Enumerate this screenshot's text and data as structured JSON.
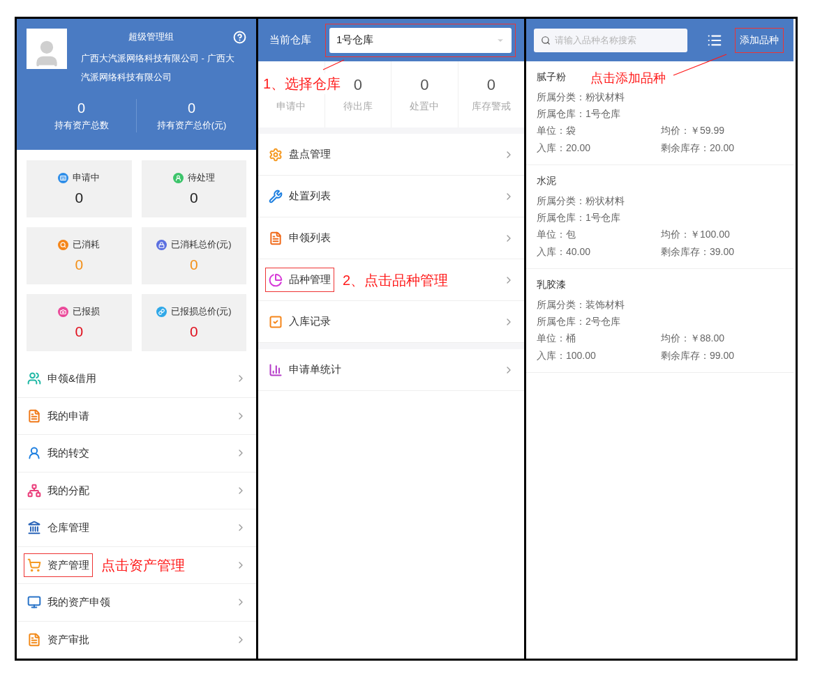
{
  "asset_screen": {
    "profile": {
      "role": "超级管理组",
      "company": "广西大汽派网络科技有限公司 - 广西大汽派网络科技有限公司"
    },
    "totals": [
      {
        "value": "0",
        "label": "持有资产总数"
      },
      {
        "value": "0",
        "label": "持有资产总价(元)"
      }
    ],
    "stat_cards": [
      {
        "label": "申请中",
        "value": "0",
        "color": "#222222"
      },
      {
        "label": "待处理",
        "value": "0",
        "color": "#222222"
      },
      {
        "label": "已消耗",
        "value": "0",
        "color": "#f39019"
      },
      {
        "label": "已消耗总价(元)",
        "value": "0",
        "color": "#f39019"
      },
      {
        "label": "已报损",
        "value": "0",
        "color": "#e0101e"
      },
      {
        "label": "已报损总价(元)",
        "value": "0",
        "color": "#e0101e"
      }
    ],
    "menu": [
      {
        "label": "申领&借用",
        "highlighted": false
      },
      {
        "label": "我的申请",
        "highlighted": false
      },
      {
        "label": "我的转交",
        "highlighted": false
      },
      {
        "label": "我的分配",
        "highlighted": false
      },
      {
        "label": "仓库管理",
        "highlighted": false
      },
      {
        "label": "资产管理",
        "highlighted": true,
        "note": "点击资产管理"
      },
      {
        "label": "我的资产申领",
        "highlighted": false
      },
      {
        "label": "资产审批",
        "highlighted": false
      }
    ]
  },
  "warehouse_screen": {
    "header": {
      "label": "当前仓库",
      "select_value": "1号仓库",
      "highlighted": true,
      "note": "1、选择仓库"
    },
    "counters": [
      {
        "label": "申请中"
      },
      {
        "value": "0",
        "label": "待出库"
      },
      {
        "value": "0",
        "label": "处置中"
      },
      {
        "value": "0",
        "label": "库存警戒"
      }
    ],
    "menu_groups": [
      [
        {
          "label": "盘点管理",
          "highlighted": false
        },
        {
          "label": "处置列表",
          "highlighted": false
        },
        {
          "label": "申领列表",
          "highlighted": false
        },
        {
          "label": "品种管理",
          "highlighted": true,
          "note": "2、点击品种管理"
        },
        {
          "label": "入库记录",
          "highlighted": false
        }
      ],
      [
        {
          "label": "申请单统计",
          "highlighted": false
        }
      ]
    ]
  },
  "variety_screen": {
    "search": {
      "placeholder": "请输入品种名称搜索"
    },
    "add_button": {
      "label": "添加品种",
      "highlighted": true,
      "note": "点击添加品种"
    },
    "products": [
      {
        "name": "腻子粉",
        "category": "所属分类：粉状材料",
        "warehouse": "所属仓库：1号仓库",
        "unit": "单位：袋",
        "price": "均价：￥59.99",
        "stock_in": "入库：20.00",
        "remaining": "剩余库存：20.00"
      },
      {
        "name": "水泥",
        "category": "所属分类：粉状材料",
        "warehouse": "所属仓库：1号仓库",
        "unit": "单位：包",
        "price": "均价：￥100.00",
        "stock_in": "入库：40.00",
        "remaining": "剩余库存：39.00"
      },
      {
        "name": "乳胶漆",
        "category": "所属分类：装饰材料",
        "warehouse": "所属仓库：2号仓库",
        "unit": "单位：桶",
        "price": "均价：￥88.00",
        "stock_in": "入库：100.00",
        "remaining": "剩余库存：99.00"
      }
    ]
  }
}
